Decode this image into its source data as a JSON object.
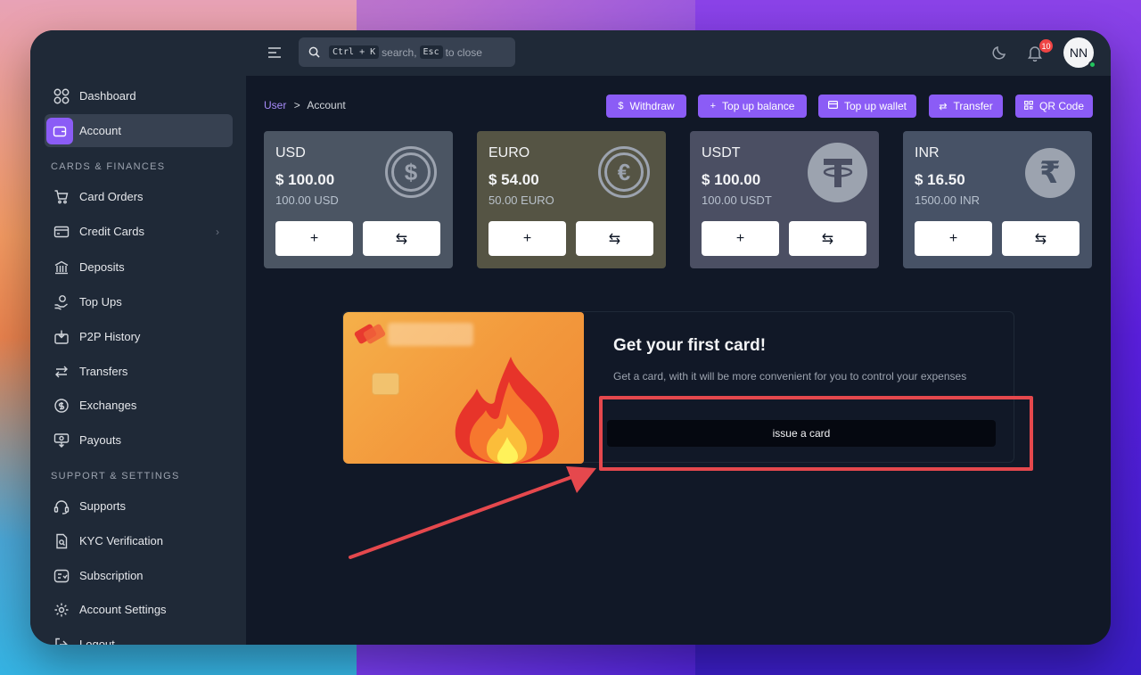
{
  "search": {
    "kbd1": "Ctrl + K",
    "text1": "search,",
    "kbd2": "Esc",
    "text2": "to close"
  },
  "notifications": {
    "count": "10"
  },
  "user": {
    "initials": "NN"
  },
  "sidebar": {
    "items_top": [
      {
        "label": "Dashboard",
        "icon": "grid-icon"
      },
      {
        "label": "Account",
        "icon": "wallet-icon"
      }
    ],
    "section_finances": "CARDS & FINANCES",
    "items_finances": [
      {
        "label": "Card Orders",
        "icon": "cart-icon"
      },
      {
        "label": "Credit Cards",
        "icon": "credit-card-icon"
      },
      {
        "label": "Deposits",
        "icon": "bank-icon"
      },
      {
        "label": "Top Ups",
        "icon": "hand-coins-icon"
      },
      {
        "label": "P2P History",
        "icon": "download-box-icon"
      },
      {
        "label": "Transfers",
        "icon": "arrows-left-right-icon"
      },
      {
        "label": "Exchanges",
        "icon": "currency-exchange-icon"
      },
      {
        "label": "Payouts",
        "icon": "cash-payout-icon"
      }
    ],
    "section_support": "SUPPORT & SETTINGS",
    "items_support": [
      {
        "label": "Supports",
        "icon": "headset-icon"
      },
      {
        "label": "KYC Verification",
        "icon": "id-doc-icon"
      },
      {
        "label": "Subscription",
        "icon": "subscription-icon"
      },
      {
        "label": "Account Settings",
        "icon": "gear-icon"
      },
      {
        "label": "Logout",
        "icon": "logout-icon"
      }
    ]
  },
  "breadcrumb": {
    "root": "User",
    "separator": ">",
    "current": "Account"
  },
  "actions": [
    {
      "label": "Withdraw",
      "icon": "$"
    },
    {
      "label": "Top up balance",
      "icon": "+"
    },
    {
      "label": "Top up wallet",
      "icon": "▭"
    },
    {
      "label": "Transfer",
      "icon": "⇄"
    },
    {
      "label": "QR Code",
      "icon": "qr"
    }
  ],
  "currencies": [
    {
      "name": "USD",
      "amount": "$ 100.00",
      "sub": "100.00 USD",
      "symbol": "$",
      "bg": "#4b5563"
    },
    {
      "name": "EURO",
      "amount": "$ 54.00",
      "sub": "50.00 EURO",
      "symbol": "€",
      "bg": "#555444"
    },
    {
      "name": "USDT",
      "amount": "$ 100.00",
      "sub": "100.00 USDT",
      "symbol": "₮",
      "bg": "#4b4f63"
    },
    {
      "name": "INR",
      "amount": "$ 16.50",
      "sub": "1500.00 INR",
      "symbol": "₹",
      "bg": "#475266"
    }
  ],
  "card_buttons": {
    "add": "+",
    "exchange": "⇆"
  },
  "promo": {
    "title": "Get your first card!",
    "description": "Get a card, with it will be more convenient for you to control your expenses",
    "button": "issue a card"
  },
  "colors": {
    "accent": "#8b5cf6",
    "highlight": "#e5484d",
    "background": "#111827",
    "panel": "#1f2937"
  }
}
